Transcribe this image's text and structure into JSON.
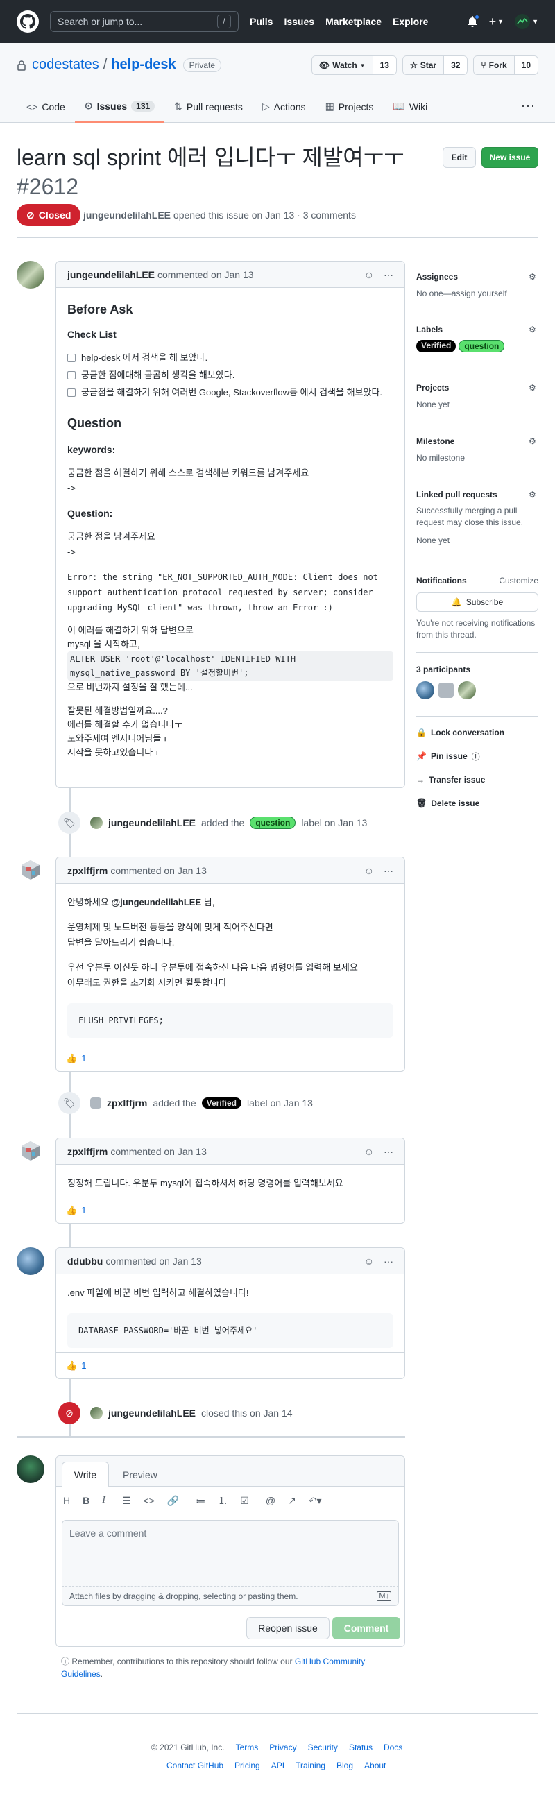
{
  "header": {
    "search_placeholder": "Search or jump to...",
    "search_kbd": "/",
    "nav": [
      "Pulls",
      "Issues",
      "Marketplace",
      "Explore"
    ]
  },
  "repo": {
    "owner": "codestates",
    "slash": "/",
    "name": "help-desk",
    "visibility": "Private",
    "watch_label": "Watch",
    "watch_count": "13",
    "star_label": "Star",
    "star_count": "32",
    "fork_label": "Fork",
    "fork_count": "10",
    "tabs": [
      {
        "label": "Code"
      },
      {
        "label": "Issues",
        "count": "131"
      },
      {
        "label": "Pull requests"
      },
      {
        "label": "Actions"
      },
      {
        "label": "Projects"
      },
      {
        "label": "Wiki"
      }
    ]
  },
  "issue": {
    "title": "learn sql sprint 에러 입니다ㅜ 제발여ㅜㅜ",
    "number": "#2612",
    "edit_label": "Edit",
    "new_issue_label": "New issue",
    "state": "Closed",
    "author": "jungeundelilahLEE",
    "meta": "opened this issue on Jan 13 · 3 comments"
  },
  "comment1": {
    "author": "jungeundelilahLEE",
    "meta": "commented on Jan 13",
    "h_before": "Before Ask",
    "h_checklist": "Check List",
    "checks": [
      "help-desk 에서 검색을 해 보았다.",
      "궁금한 점에대해 곰곰히 생각을 해보았다.",
      "궁금점을 해결하기 위해 여러번 Google, Stackoverflow등 에서 검색을 해보았다."
    ],
    "h_question": "Question",
    "keywords_label": "keywords:",
    "keywords_text": "궁금한 점을 해결하기 위해 스스로 검색해본 키워드를 남겨주세요",
    "arrow1": "->",
    "question_label": "Question:",
    "question_text": "궁금한 점을 남겨주세요",
    "arrow2": "->",
    "error_code": "Error: the string \"ER_NOT_SUPPORTED_AUTH_MODE: Client does not support authentication protocol requested by server; consider upgrading MySQL client\" was thrown, throw an Error :)",
    "p1_line1": "이 에러를 해결하기 위하 답변으로",
    "p1_line2": "mysql 을 시작하고,",
    "p1_code": "ALTER USER 'root'@'localhost' IDENTIFIED WITH mysql_native_password BY '설정할비번';",
    "p1_line3": "으로 비번까지 설정을 잘 했는데...",
    "p2_line1": "잘못된 해결방법일까요....?",
    "p2_line2": "에러를 해결할 수가 없습니다ㅜ",
    "p2_line3": "도와주세여 엔지니어님들ㅜ",
    "p2_line4": "시작을 못하고있습니다ㅜ"
  },
  "event1": {
    "actor": "jungeundelilahLEE",
    "pre": "added the",
    "label": "question",
    "post": "label on Jan 13"
  },
  "comment2": {
    "author": "zpxlffjrm",
    "meta": "commented on Jan 13",
    "line1_mention": "@jungeundelilahLEE",
    "line1_pre": "안녕하세요",
    "line1_post": "님,",
    "line2": "운영체제 및 노드버전 등등을 양식에 맞게 적어주신다면",
    "line3": "답변을 달아드리기 쉽습니다.",
    "line4": "우선 우분투 이신듯 하니 우분투에 접속하신 다음 다음 명령어를 입력해 보세요",
    "line5": "아무래도 권한을 초기화 시키면 될듯합니다",
    "code": "FLUSH PRIVILEGES;",
    "reaction_count": "1"
  },
  "event2": {
    "actor": "zpxlffjrm",
    "pre": "added the",
    "label": "Verified",
    "post": "label on Jan 13"
  },
  "comment3": {
    "author": "zpxlffjrm",
    "meta": "commented on Jan 13",
    "text": "정정해 드립니다. 우분투 mysql에 접속하셔서 해당 명령어를 입력해보세요",
    "reaction_count": "1"
  },
  "comment4": {
    "author": "ddubbu",
    "meta": "commented on Jan 13",
    "text": ".env 파일에 바꾼 비번 입력하고 해결하였습니다!",
    "code": "DATABASE_PASSWORD='바꾼 비번 넣어주세요'",
    "reaction_count": "1"
  },
  "event3": {
    "actor": "jungeundelilahLEE",
    "post": "closed this on Jan 14"
  },
  "editor": {
    "tab_write": "Write",
    "tab_preview": "Preview",
    "placeholder": "Leave a comment",
    "attach": "Attach files by dragging & dropping, selecting or pasting them.",
    "reopen": "Reopen issue",
    "comment": "Comment",
    "note_pre": "Remember, contributions to this repository should follow our",
    "note_link": "GitHub Community Guidelines",
    "note_post": "."
  },
  "sidebar": {
    "assignees_h": "Assignees",
    "assignees_v": "No one—assign yourself",
    "labels_h": "Labels",
    "label_verified": "Verified",
    "label_question": "question",
    "projects_h": "Projects",
    "projects_v": "None yet",
    "milestone_h": "Milestone",
    "milestone_v": "No milestone",
    "linked_h": "Linked pull requests",
    "linked_desc": "Successfully merging a pull request may close this issue.",
    "linked_v": "None yet",
    "notif_h": "Notifications",
    "customize": "Customize",
    "subscribe": "Subscribe",
    "notif_desc": "You're not receiving notifications from this thread.",
    "participants_h": "3 participants",
    "lock": "Lock conversation",
    "pin": "Pin issue",
    "transfer": "Transfer issue",
    "delete": "Delete issue"
  },
  "footer": {
    "copyright": "© 2021 GitHub, Inc.",
    "row1": [
      "Terms",
      "Privacy",
      "Security",
      "Status",
      "Docs"
    ],
    "row2": [
      "Contact GitHub",
      "Pricing",
      "API",
      "Training",
      "Blog",
      "About"
    ]
  },
  "colors": {
    "header": "#24292f",
    "closed": "#cf222e",
    "primary": "#2da44e",
    "link": "#0969da"
  }
}
